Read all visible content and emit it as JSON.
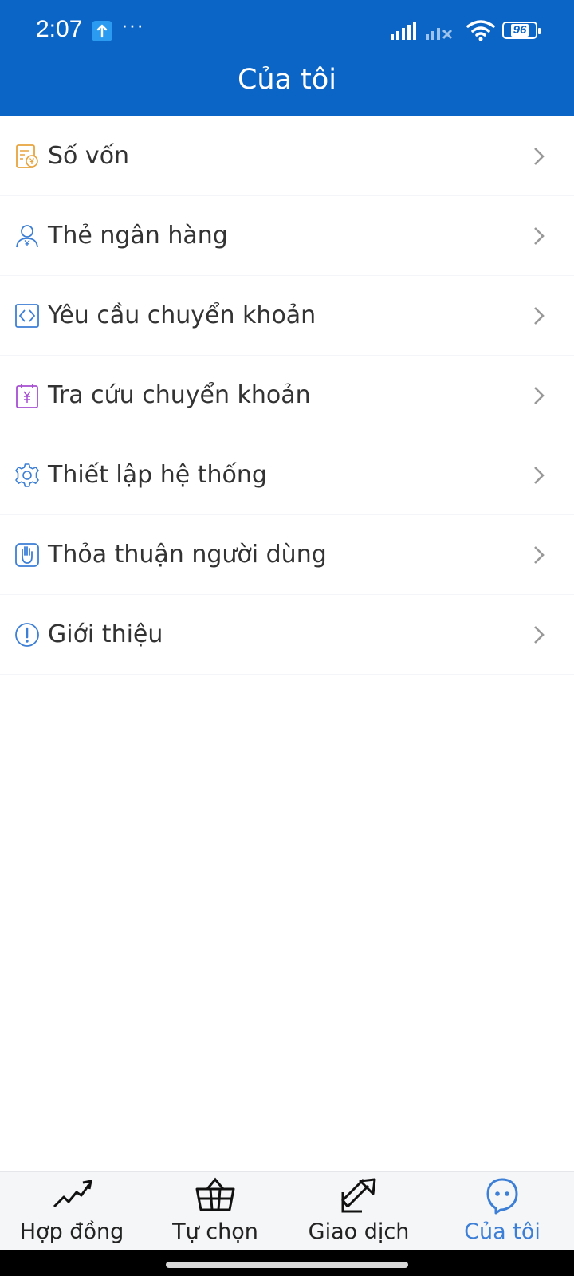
{
  "status_bar": {
    "time": "2:07",
    "dots": "···",
    "battery": "96"
  },
  "header": {
    "title": "Của tôi"
  },
  "menu": {
    "items": [
      {
        "label": "Số vốn",
        "icon": "capital-ledger-icon",
        "color": "#e8a33d"
      },
      {
        "label": "Thẻ ngân hàng",
        "icon": "user-yuan-icon",
        "color": "#3d7fd6"
      },
      {
        "label": "Yêu cầu chuyển khoản",
        "icon": "transfer-request-icon",
        "color": "#3d7fd6"
      },
      {
        "label": "Tra cứu chuyển khoản",
        "icon": "calendar-yuan-icon",
        "color": "#a64fd1"
      },
      {
        "label": "Thiết lập hệ thống",
        "icon": "gear-icon",
        "color": "#3d7fd6"
      },
      {
        "label": "Thỏa thuận người dùng",
        "icon": "hand-icon",
        "color": "#3d7fd6"
      },
      {
        "label": "Giới thiệu",
        "icon": "info-exclamation-icon",
        "color": "#3d7fd6"
      }
    ]
  },
  "tabbar": {
    "tabs": [
      {
        "label": "Hợp đồng",
        "icon": "trend-chart-icon",
        "active": false
      },
      {
        "label": "Tự chọn",
        "icon": "basket-icon",
        "active": false
      },
      {
        "label": "Giao dịch",
        "icon": "trade-arrow-icon",
        "active": false
      },
      {
        "label": "Của tôi",
        "icon": "profile-face-icon",
        "active": true
      }
    ]
  },
  "colors": {
    "header_bg": "#0b65c6",
    "active_tab": "#3d7fd6",
    "text": "#333333"
  }
}
